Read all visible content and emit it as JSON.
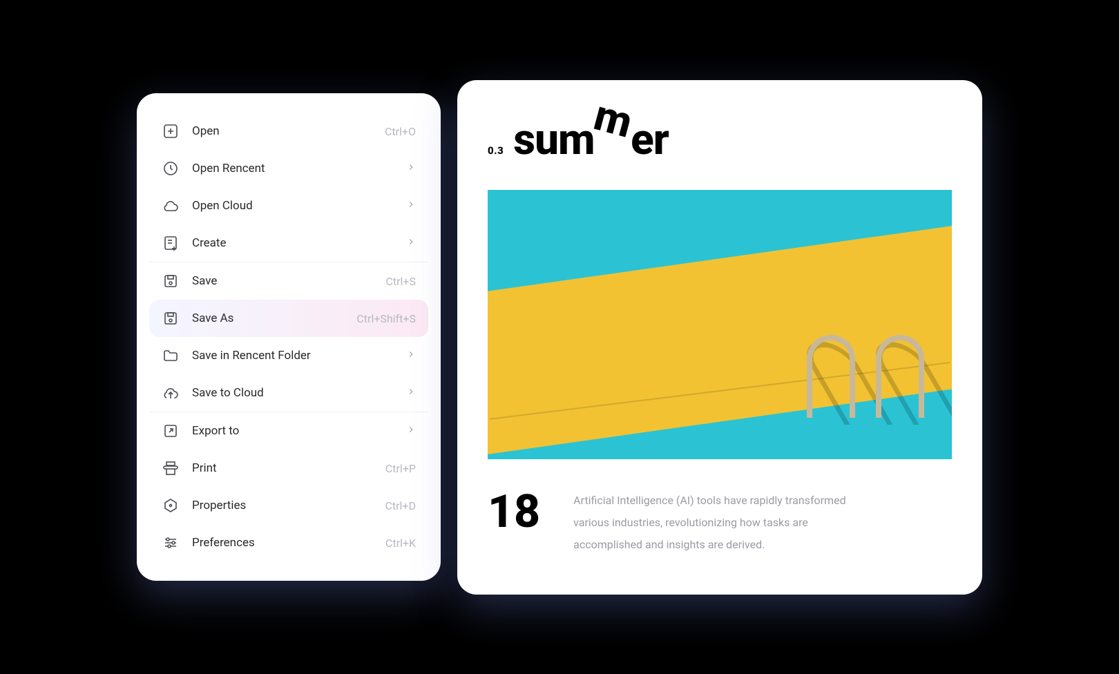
{
  "menu": {
    "groups": [
      {
        "items": [
          {
            "icon": "plus-square",
            "label": "Open",
            "shortcut": "Ctrl+O",
            "arrow": false,
            "highlighted": false
          },
          {
            "icon": "clock",
            "label": "Open Rencent",
            "shortcut": "",
            "arrow": true,
            "highlighted": false
          },
          {
            "icon": "cloud",
            "label": "Open Cloud",
            "shortcut": "",
            "arrow": true,
            "highlighted": false
          },
          {
            "icon": "file-plus",
            "label": "Create",
            "shortcut": "",
            "arrow": true,
            "highlighted": false
          }
        ]
      },
      {
        "items": [
          {
            "icon": "save",
            "label": "Save",
            "shortcut": "Ctrl+S",
            "arrow": false,
            "highlighted": false
          },
          {
            "icon": "save-as",
            "label": "Save As",
            "shortcut": "Ctrl+Shift+S",
            "arrow": false,
            "highlighted": true
          },
          {
            "icon": "folder",
            "label": "Save in Rencent Folder",
            "shortcut": "",
            "arrow": true,
            "highlighted": false
          },
          {
            "icon": "cloud-upload",
            "label": "Save to Cloud",
            "shortcut": "",
            "arrow": true,
            "highlighted": false
          }
        ]
      },
      {
        "items": [
          {
            "icon": "export",
            "label": "Export to",
            "shortcut": "",
            "arrow": true,
            "highlighted": false
          },
          {
            "icon": "print",
            "label": "Print",
            "shortcut": "Ctrl+P",
            "arrow": false,
            "highlighted": false
          },
          {
            "icon": "hexagon",
            "label": "Properties",
            "shortcut": "Ctrl+D",
            "arrow": false,
            "highlighted": false
          },
          {
            "icon": "sliders",
            "label": "Preferences",
            "shortcut": "Ctrl+K",
            "arrow": false,
            "highlighted": false
          }
        ]
      }
    ]
  },
  "content": {
    "index": "0.3",
    "title_part1": "sum",
    "title_m": "m",
    "title_part2": "er",
    "number": "18",
    "body": "Artificial Intelligence (AI) tools have rapidly transformed various industries, revolutionizing how tasks are accomplished and insights are derived."
  }
}
